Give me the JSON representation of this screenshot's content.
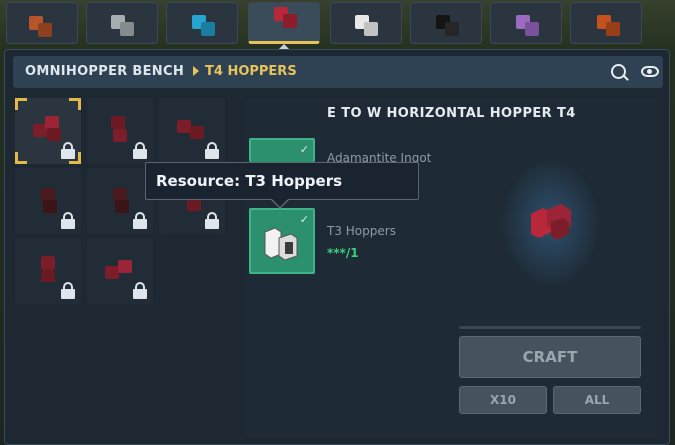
{
  "header": {
    "bench": "OMNIHOPPER BENCH",
    "category": "T4 HOPPERS"
  },
  "tabs": [
    {
      "icon": "copper-hopper-icon",
      "color": "#b6552c"
    },
    {
      "icon": "iron-hopper-icon",
      "color": "#a8adb0"
    },
    {
      "icon": "cyan-hopper-icon",
      "color": "#24a6d1"
    },
    {
      "icon": "red-hopper-icon",
      "color": "#b8283a",
      "active": true
    },
    {
      "icon": "white-hopper-icon",
      "color": "#e8e8e8"
    },
    {
      "icon": "black-hopper-icon",
      "color": "#1a1a1a"
    },
    {
      "icon": "purple-hopper-icon",
      "color": "#9b6bc2"
    },
    {
      "icon": "orange-hopper-icon",
      "color": "#c4521f"
    }
  ],
  "recipe": {
    "title": "E TO W HORIZONTAL HOPPER T4",
    "ingredients": [
      {
        "name": "Adamantite Ingot",
        "count": ""
      },
      {
        "name": "T3 Hoppers",
        "count": "***/1"
      }
    ]
  },
  "tooltip": {
    "text": "Resource: T3 Hoppers"
  },
  "buttons": {
    "craft": "CRAFT",
    "x10": "X10",
    "all": "ALL"
  },
  "colors": {
    "accent": "#e7c45a",
    "ingredient_bg": "#2c8f6d",
    "count_ok": "#39d07d"
  }
}
